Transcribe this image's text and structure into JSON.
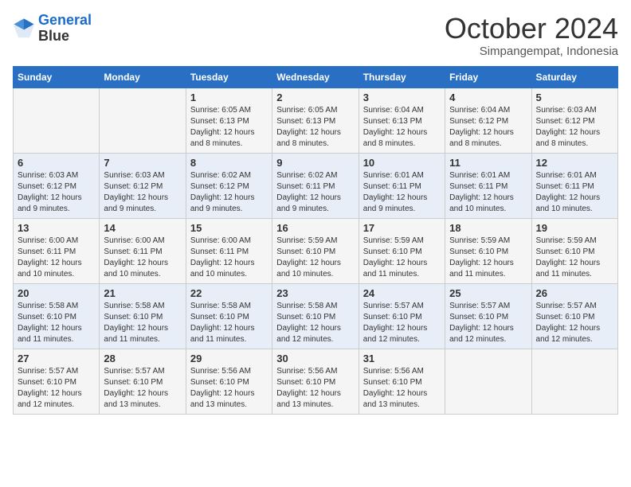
{
  "header": {
    "logo_line1": "General",
    "logo_line2": "Blue",
    "month": "October 2024",
    "location": "Simpangempat, Indonesia"
  },
  "weekdays": [
    "Sunday",
    "Monday",
    "Tuesday",
    "Wednesday",
    "Thursday",
    "Friday",
    "Saturday"
  ],
  "weeks": [
    [
      {
        "day": "",
        "info": ""
      },
      {
        "day": "",
        "info": ""
      },
      {
        "day": "1",
        "info": "Sunrise: 6:05 AM\nSunset: 6:13 PM\nDaylight: 12 hours and 8 minutes."
      },
      {
        "day": "2",
        "info": "Sunrise: 6:05 AM\nSunset: 6:13 PM\nDaylight: 12 hours and 8 minutes."
      },
      {
        "day": "3",
        "info": "Sunrise: 6:04 AM\nSunset: 6:13 PM\nDaylight: 12 hours and 8 minutes."
      },
      {
        "day": "4",
        "info": "Sunrise: 6:04 AM\nSunset: 6:12 PM\nDaylight: 12 hours and 8 minutes."
      },
      {
        "day": "5",
        "info": "Sunrise: 6:03 AM\nSunset: 6:12 PM\nDaylight: 12 hours and 8 minutes."
      }
    ],
    [
      {
        "day": "6",
        "info": "Sunrise: 6:03 AM\nSunset: 6:12 PM\nDaylight: 12 hours and 9 minutes."
      },
      {
        "day": "7",
        "info": "Sunrise: 6:03 AM\nSunset: 6:12 PM\nDaylight: 12 hours and 9 minutes."
      },
      {
        "day": "8",
        "info": "Sunrise: 6:02 AM\nSunset: 6:12 PM\nDaylight: 12 hours and 9 minutes."
      },
      {
        "day": "9",
        "info": "Sunrise: 6:02 AM\nSunset: 6:11 PM\nDaylight: 12 hours and 9 minutes."
      },
      {
        "day": "10",
        "info": "Sunrise: 6:01 AM\nSunset: 6:11 PM\nDaylight: 12 hours and 9 minutes."
      },
      {
        "day": "11",
        "info": "Sunrise: 6:01 AM\nSunset: 6:11 PM\nDaylight: 12 hours and 10 minutes."
      },
      {
        "day": "12",
        "info": "Sunrise: 6:01 AM\nSunset: 6:11 PM\nDaylight: 12 hours and 10 minutes."
      }
    ],
    [
      {
        "day": "13",
        "info": "Sunrise: 6:00 AM\nSunset: 6:11 PM\nDaylight: 12 hours and 10 minutes."
      },
      {
        "day": "14",
        "info": "Sunrise: 6:00 AM\nSunset: 6:11 PM\nDaylight: 12 hours and 10 minutes."
      },
      {
        "day": "15",
        "info": "Sunrise: 6:00 AM\nSunset: 6:11 PM\nDaylight: 12 hours and 10 minutes."
      },
      {
        "day": "16",
        "info": "Sunrise: 5:59 AM\nSunset: 6:10 PM\nDaylight: 12 hours and 10 minutes."
      },
      {
        "day": "17",
        "info": "Sunrise: 5:59 AM\nSunset: 6:10 PM\nDaylight: 12 hours and 11 minutes."
      },
      {
        "day": "18",
        "info": "Sunrise: 5:59 AM\nSunset: 6:10 PM\nDaylight: 12 hours and 11 minutes."
      },
      {
        "day": "19",
        "info": "Sunrise: 5:59 AM\nSunset: 6:10 PM\nDaylight: 12 hours and 11 minutes."
      }
    ],
    [
      {
        "day": "20",
        "info": "Sunrise: 5:58 AM\nSunset: 6:10 PM\nDaylight: 12 hours and 11 minutes."
      },
      {
        "day": "21",
        "info": "Sunrise: 5:58 AM\nSunset: 6:10 PM\nDaylight: 12 hours and 11 minutes."
      },
      {
        "day": "22",
        "info": "Sunrise: 5:58 AM\nSunset: 6:10 PM\nDaylight: 12 hours and 11 minutes."
      },
      {
        "day": "23",
        "info": "Sunrise: 5:58 AM\nSunset: 6:10 PM\nDaylight: 12 hours and 12 minutes."
      },
      {
        "day": "24",
        "info": "Sunrise: 5:57 AM\nSunset: 6:10 PM\nDaylight: 12 hours and 12 minutes."
      },
      {
        "day": "25",
        "info": "Sunrise: 5:57 AM\nSunset: 6:10 PM\nDaylight: 12 hours and 12 minutes."
      },
      {
        "day": "26",
        "info": "Sunrise: 5:57 AM\nSunset: 6:10 PM\nDaylight: 12 hours and 12 minutes."
      }
    ],
    [
      {
        "day": "27",
        "info": "Sunrise: 5:57 AM\nSunset: 6:10 PM\nDaylight: 12 hours and 12 minutes."
      },
      {
        "day": "28",
        "info": "Sunrise: 5:57 AM\nSunset: 6:10 PM\nDaylight: 12 hours and 13 minutes."
      },
      {
        "day": "29",
        "info": "Sunrise: 5:56 AM\nSunset: 6:10 PM\nDaylight: 12 hours and 13 minutes."
      },
      {
        "day": "30",
        "info": "Sunrise: 5:56 AM\nSunset: 6:10 PM\nDaylight: 12 hours and 13 minutes."
      },
      {
        "day": "31",
        "info": "Sunrise: 5:56 AM\nSunset: 6:10 PM\nDaylight: 12 hours and 13 minutes."
      },
      {
        "day": "",
        "info": ""
      },
      {
        "day": "",
        "info": ""
      }
    ]
  ]
}
